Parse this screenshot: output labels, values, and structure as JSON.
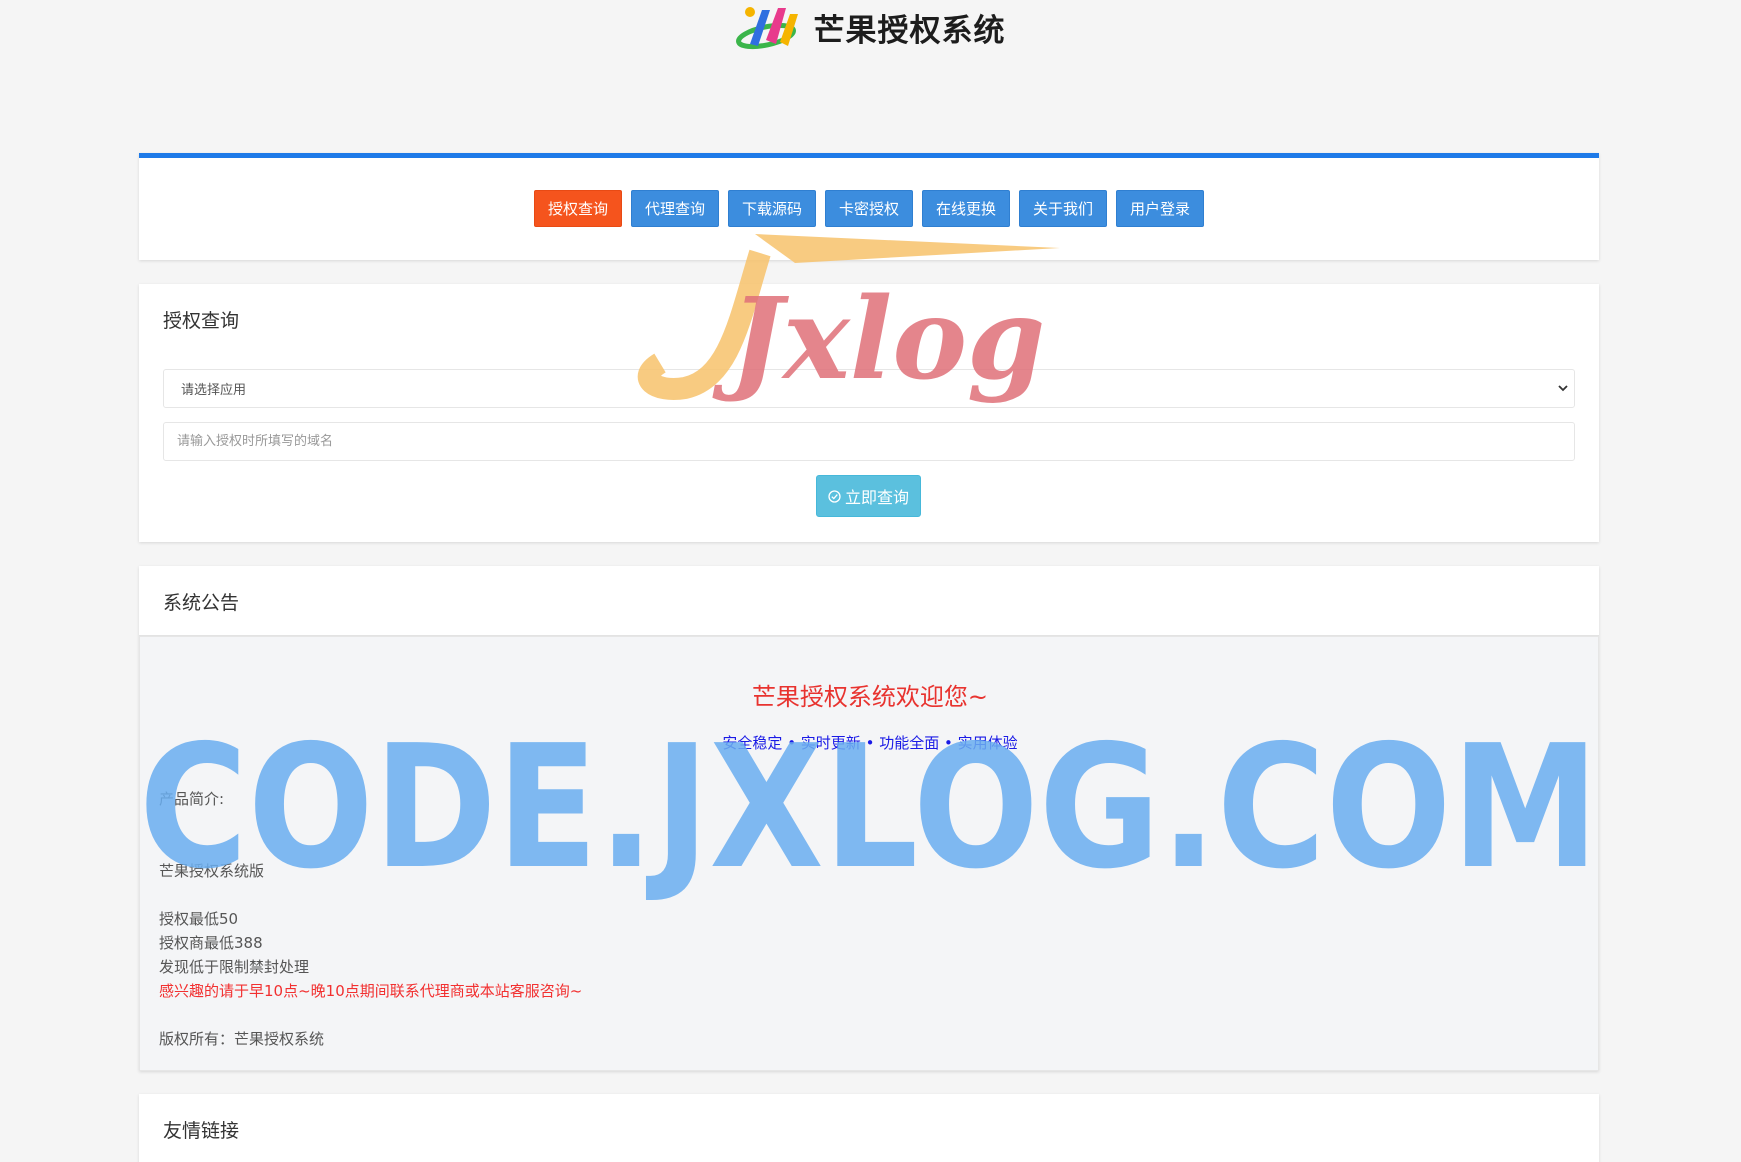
{
  "header": {
    "title": "芒果授权系统",
    "logo_icon": "mango-logo-icon"
  },
  "nav": {
    "buttons": [
      {
        "label": "授权查询",
        "active": true
      },
      {
        "label": "代理查询",
        "active": false
      },
      {
        "label": "下载源码",
        "active": false
      },
      {
        "label": "卡密授权",
        "active": false
      },
      {
        "label": "在线更换",
        "active": false
      },
      {
        "label": "关于我们",
        "active": false
      },
      {
        "label": "用户登录",
        "active": false
      }
    ]
  },
  "query": {
    "title": "授权查询",
    "select_value": "请选择应用",
    "domain_placeholder": "请输入授权时所填写的域名",
    "submit_label": "立即查询"
  },
  "notice": {
    "title": "系统公告",
    "welcome": "芒果授权系统欢迎您~",
    "slogan": "安全稳定 • 实时更新 • 功能全面 • 实用体验",
    "intro_label": "产品简介:",
    "version": "芒果授权系统版",
    "price_min": "授权最低50",
    "agent_min": "授权商最低388",
    "ban_rule": "发现低于限制禁封处理",
    "contact": "感兴趣的请于早10点~晚10点期间联系代理商或本站客服咨询~",
    "copyright": "版权所有：芒果授权系统"
  },
  "links": {
    "title": "友情链接"
  },
  "watermarks": {
    "logo_text": "Jxlog",
    "url_text": "CODE.JXLOG.COM"
  },
  "colors": {
    "accent_blue": "#1e7ae8",
    "nav_button": "#3c8dde",
    "nav_active": "#f5541d",
    "query_button": "#5bc0de",
    "welcome_red": "#e8332f",
    "slogan_blue": "#1a1ae6"
  }
}
